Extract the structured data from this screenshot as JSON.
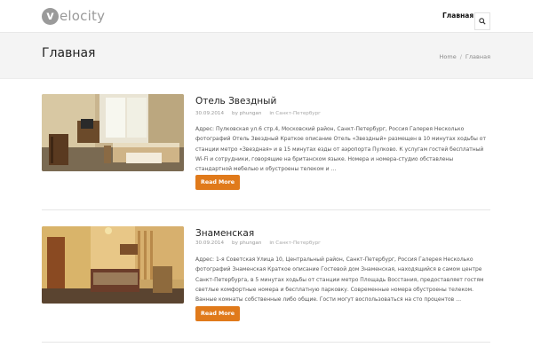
{
  "site": {
    "logo_letter": "v",
    "logo_rest": "elocity"
  },
  "nav": {
    "items": [
      {
        "label": "Главная"
      }
    ]
  },
  "page": {
    "title": "Главная"
  },
  "breadcrumb": {
    "home": "Home",
    "separator": "/",
    "current": "Главная"
  },
  "posts": [
    {
      "title": "Отель Звездный",
      "date": "30.09.2014",
      "author_prefix": "by",
      "author": "phungan",
      "category_prefix": "in",
      "category": "Санкт-Петербург",
      "excerpt": "Адрес: Пулковская ул.6 стр.4, Московский район, Санкт-Петербург, Россия Галерея Несколько фотографий Отель Звездный Краткое описание Отель «Звездный» размещен в 10 минутах ходьбы от станции метро «Звездная» и в 15 минутах езды от аэропорта Пулково. К услугам гостей бесплатный Wi-Fi и сотрудники, говорящие на британском языке. Номера и номера-студио обставлены стандартной мебелью и обустроены телеком и …",
      "read_more": "Read More"
    },
    {
      "title": "Знаменская",
      "date": "30.09.2014",
      "author_prefix": "by",
      "author": "phungan",
      "category_prefix": "in",
      "category": "Санкт-Петербург",
      "excerpt": "Адрес: 1-я Советская Улица 10, Центральный район, Санкт-Петербург, Россия Галерея Несколько фотографий Знаменская Краткое описание Гостевой дом Знаменская, находящийся в самом центре Санкт-Петербурга, в 5 минутах ходьбы от станции метро Площадь Восстания, предоставляет гостям светлые комфортные номера и бесплатную парковку. Современные номера обустроены телеком. Ванные комнаты собственные либо общие. Гости могут воспользоваться на сто процентов …",
      "read_more": "Read More"
    }
  ],
  "colors": {
    "accent": "#e07a1b",
    "logo": "#9a9a9a",
    "band": "#f4f4f4"
  }
}
